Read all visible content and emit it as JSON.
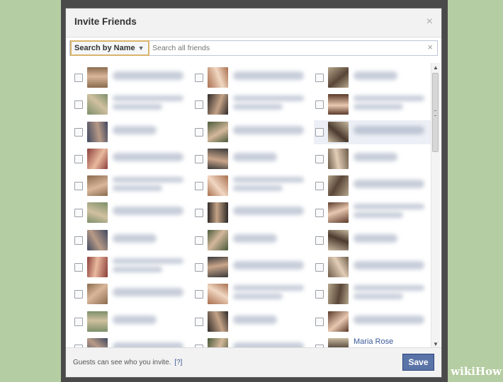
{
  "dialog": {
    "title": "Invite Friends",
    "close_icon": "×"
  },
  "search": {
    "mode_label": "Search by Name",
    "placeholder": "Search all friends",
    "clear_icon": "×"
  },
  "friends_partial_label": "Maria Rose",
  "footer": {
    "info_text": "Guests can see who you invite.",
    "help_link": "[?]",
    "save_label": "Save"
  },
  "watermark": {
    "text": "wikiHow"
  },
  "colors": {
    "accent": "#5b74a8",
    "search_highlight": "#d9b36b",
    "page_bg": "#b5cda2"
  }
}
